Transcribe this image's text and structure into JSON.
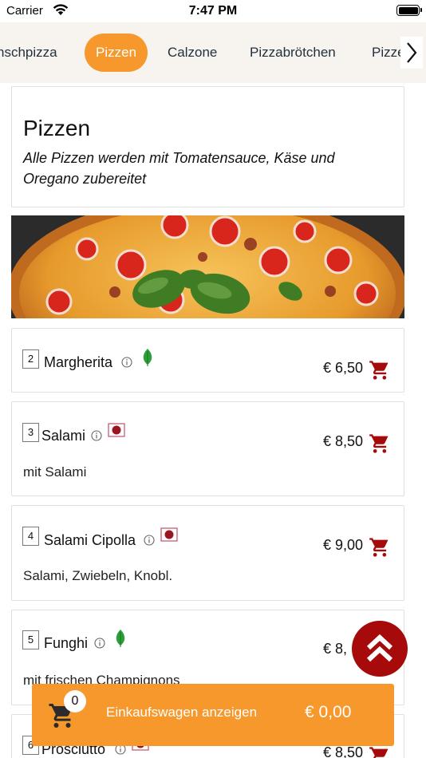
{
  "status_bar": {
    "carrier": "Carrier",
    "time": "7:47 PM"
  },
  "tabs": [
    {
      "label": "Flammkuchen/Wunschpizza",
      "visible_text": "nschpizza",
      "active": false
    },
    {
      "label": "Pizzen",
      "active": true
    },
    {
      "label": "Calzone",
      "active": false
    },
    {
      "label": "Pizzabrötchen",
      "active": false
    },
    {
      "label": "Pizza",
      "visible_text": "Pizze",
      "active": false
    }
  ],
  "section": {
    "title": "Pizzen",
    "description": "Alle Pizzen werden mit Tomatensauce, Käse und Oregano zubereitet"
  },
  "items": [
    {
      "number": "2",
      "name": "Margherita",
      "badge": "leaf-icon",
      "price": "€ 6,50",
      "description": ""
    },
    {
      "number": "3",
      "name": "Salami",
      "badge": "meat-icon",
      "price": "€ 8,50",
      "description": "mit Salami"
    },
    {
      "number": "4",
      "name": "Salami Cipolla",
      "badge": "meat-icon",
      "price": "€ 9,00",
      "description": "Salami, Zwiebeln, Knobl."
    },
    {
      "number": "5",
      "name": "Funghi",
      "badge": "leaf-icon",
      "price": "€ 8,",
      "description": "mit frischen Champignons"
    },
    {
      "number": "6",
      "name": "Prosciutto",
      "badge": "meat-icon",
      "price": "€ 8,50",
      "description": ""
    }
  ],
  "cart": {
    "count": "0",
    "label": "Einkaufswagen anzeigen",
    "total": "€ 0,00"
  },
  "colors": {
    "accent": "#f6982b",
    "dark_red": "#a60a0a",
    "veg_green": "#2e9e3a",
    "tab_bg": "#f7f3ef"
  }
}
